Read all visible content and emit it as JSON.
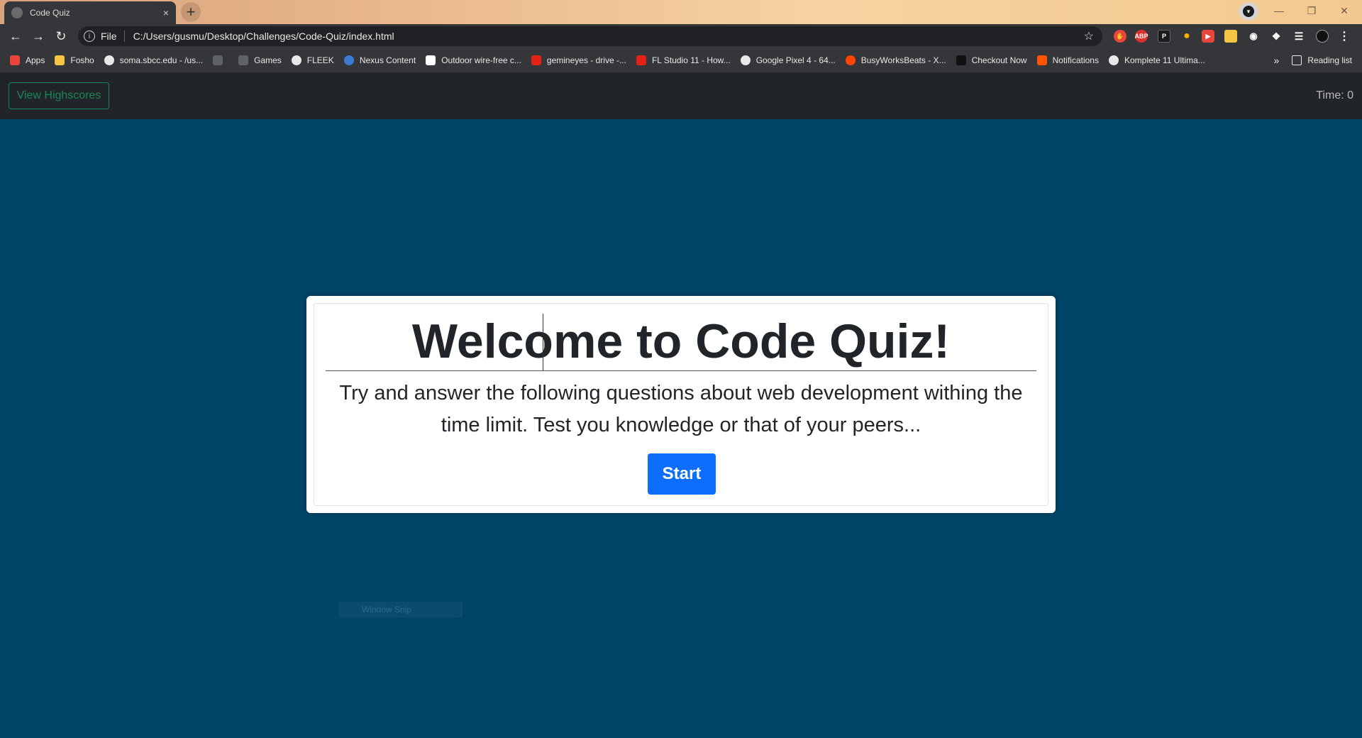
{
  "browser": {
    "tab_title": "Code Quiz",
    "tab_close": "×",
    "new_tab": "+",
    "scheme": "File",
    "url": "C:/Users/gusmu/Desktop/Challenges/Code-Quiz/index.html",
    "ext_abp": "ABP",
    "ext_p": "P",
    "bookmarks": [
      {
        "label": "Apps",
        "icon": "apps-grid-icon",
        "color": "#e8453c"
      },
      {
        "label": "Fosho",
        "icon": "folder-icon",
        "color": "#f4c542"
      },
      {
        "label": "soma.sbcc.edu - /us...",
        "icon": "globe-icon",
        "color": "#e8e8e8"
      },
      {
        "label": "",
        "icon": "blank-page-icon",
        "color": "#5f6368"
      },
      {
        "label": "Games",
        "icon": "folder-icon",
        "color": "#5f6368"
      },
      {
        "label": "FLEEK",
        "icon": "globe-icon",
        "color": "#e8e8e8"
      },
      {
        "label": "Nexus Content",
        "icon": "nexus-icon",
        "color": "#3d7ad6"
      },
      {
        "label": "Outdoor wire-free c...",
        "icon": "amazon-icon",
        "color": "#ffffff"
      },
      {
        "label": "gemineyes - drive -...",
        "icon": "youtube-icon",
        "color": "#e62117"
      },
      {
        "label": "FL Studio 11 - How...",
        "icon": "youtube-icon",
        "color": "#e62117"
      },
      {
        "label": "Google Pixel 4 - 64...",
        "icon": "globe-icon",
        "color": "#e8e8e8"
      },
      {
        "label": "BusyWorksBeats - X...",
        "icon": "reddit-icon",
        "color": "#ff4500"
      },
      {
        "label": "Checkout Now",
        "icon": "checkout-icon",
        "color": "#111111"
      },
      {
        "label": "Notifications",
        "icon": "soundcloud-icon",
        "color": "#ff5500"
      },
      {
        "label": "Komplete 11 Ultima...",
        "icon": "globe-icon",
        "color": "#e8e8e8"
      }
    ],
    "overflow": "»",
    "reading_list": "Reading list"
  },
  "navbar": {
    "highscores_label": "View Highscores",
    "timer": "Time: 0"
  },
  "card": {
    "title": "Welcome to Code Quiz!",
    "description": "Try and answer the following questions about web development withing the time limit. Test you knowledge or that of your peers...",
    "start_label": "Start"
  },
  "overlay": {
    "snip_label": "Window Snip"
  },
  "colors": {
    "page_bg": "#004466",
    "navbar_bg": "#212529",
    "highscores_accent": "#198754",
    "start_button": "#0d6efd"
  }
}
